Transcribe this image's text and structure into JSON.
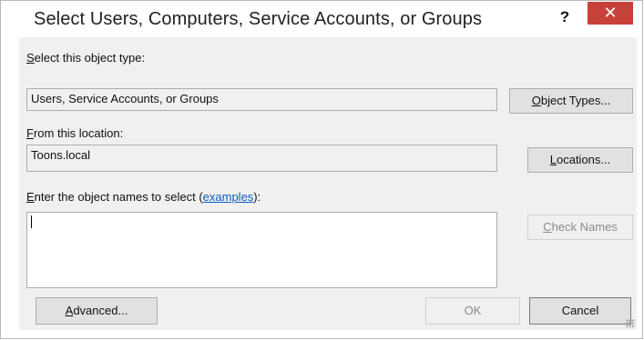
{
  "window": {
    "title": "Select Users, Computers, Service Accounts, or Groups",
    "help_label": "?",
    "close_label": "✕"
  },
  "object_type": {
    "label_accesskey": "S",
    "label_rest": "elect this object type:",
    "value": "Users, Service Accounts, or Groups",
    "button_accesskey": "O",
    "button_rest": "bject Types..."
  },
  "location": {
    "label_accesskey": "F",
    "label_rest": "rom this location:",
    "value": "Toons.local",
    "button_accesskey": "L",
    "button_rest": "ocations..."
  },
  "names": {
    "label_accesskey": "E",
    "label_rest": "nter the object names to select (",
    "link": "examples",
    "label_end": "):",
    "value": "",
    "check_accesskey": "C",
    "check_rest": "heck Names"
  },
  "footer": {
    "advanced_accesskey": "A",
    "advanced_rest": "dvanced...",
    "ok_label": "OK",
    "cancel_label": "Cancel"
  }
}
